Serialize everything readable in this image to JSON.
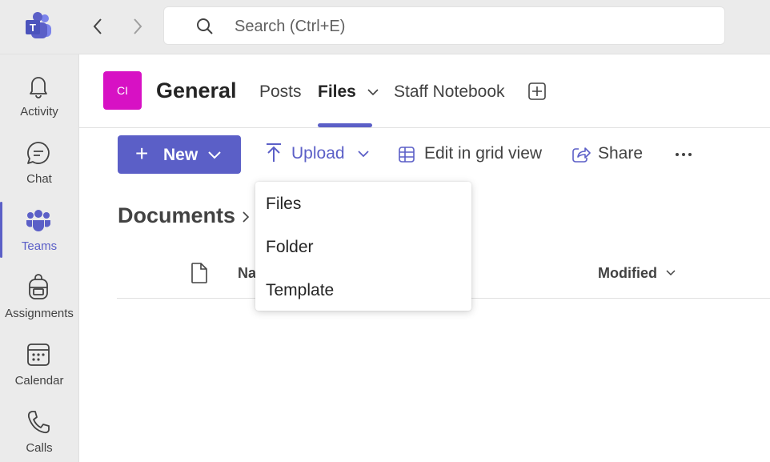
{
  "search": {
    "placeholder": "Search (Ctrl+E)"
  },
  "rail": {
    "items": [
      {
        "label": "Activity",
        "icon": "bell-icon"
      },
      {
        "label": "Chat",
        "icon": "chat-icon"
      },
      {
        "label": "Teams",
        "icon": "teams-icon",
        "active": true
      },
      {
        "label": "Assignments",
        "icon": "backpack-icon"
      },
      {
        "label": "Calendar",
        "icon": "calendar-icon"
      },
      {
        "label": "Calls",
        "icon": "phone-icon"
      }
    ]
  },
  "channel": {
    "avatar_initials": "CI",
    "avatar_color": "#d711c4",
    "title": "General",
    "tabs": [
      {
        "label": "Posts"
      },
      {
        "label": "Files",
        "active": true
      },
      {
        "label": "Staff Notebook"
      }
    ]
  },
  "toolbar": {
    "new_label": "New",
    "upload_label": "Upload",
    "grid_label": "Edit in grid view",
    "share_label": "Share"
  },
  "upload_menu": {
    "items": [
      "Files",
      "Folder",
      "Template"
    ]
  },
  "documents": {
    "title": "Documents",
    "columns": {
      "name": "Na",
      "modified": "Modified"
    }
  },
  "colors": {
    "accent": "#5b5fc7"
  }
}
